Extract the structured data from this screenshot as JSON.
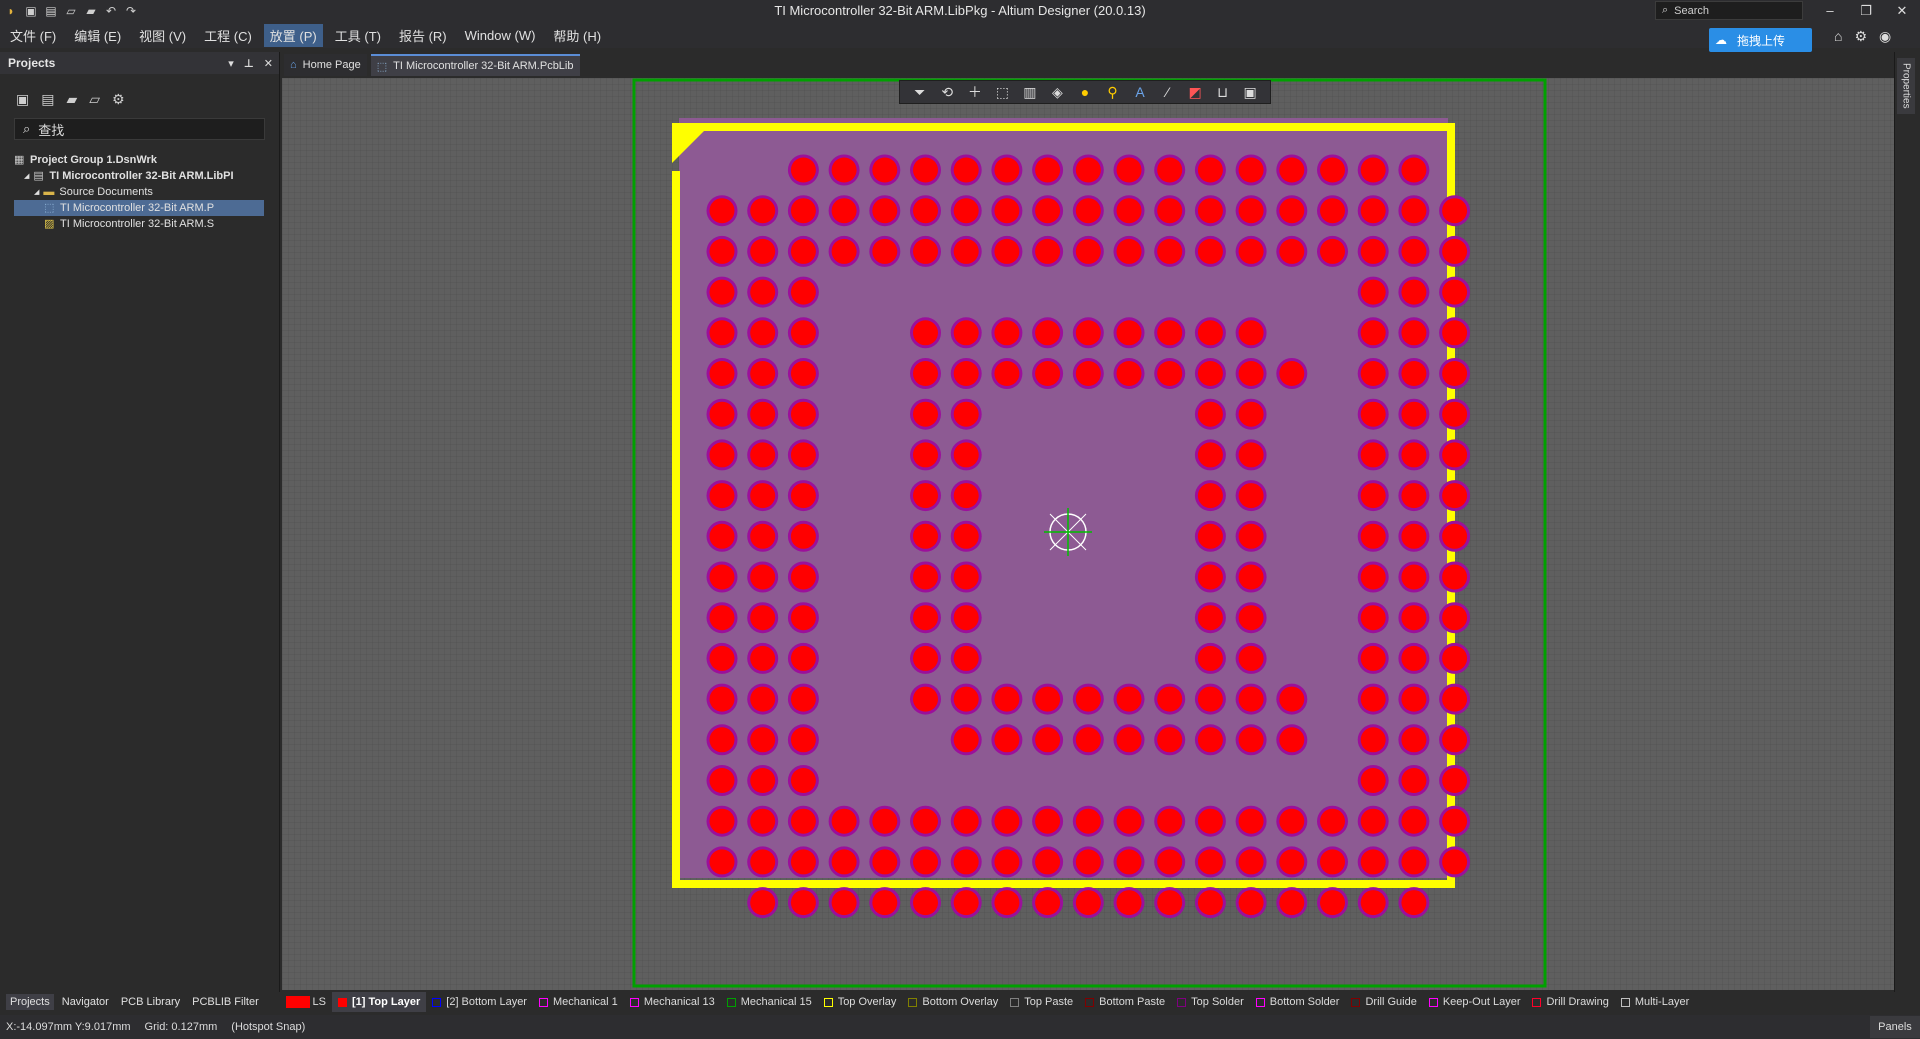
{
  "window": {
    "title": "TI Microcontroller 32-Bit ARM.LibPkg - Altium Designer (20.0.13)",
    "search_placeholder": "Search"
  },
  "menu": [
    "文件 (F)",
    "编辑 (E)",
    "视图 (V)",
    "工程 (C)",
    "放置 (P)",
    "工具 (T)",
    "报告 (R)",
    "Window (W)",
    "帮助 (H)"
  ],
  "active_menu_index": 4,
  "upload_button": "拖拽上传",
  "projects_panel": {
    "title": "Projects",
    "search_value": "查找",
    "tree": [
      {
        "label": "Project Group 1.DsnWrk",
        "level": 0,
        "bold": true,
        "icon": "project-group-icon"
      },
      {
        "label": "TI Microcontroller 32-Bit ARM.LibPI",
        "level": 1,
        "bold": true,
        "icon": "library-package-icon"
      },
      {
        "label": "Source Documents",
        "level": 2,
        "bold": false,
        "icon": "folder-icon"
      },
      {
        "label": "TI Microcontroller 32-Bit ARM.P",
        "level": 3,
        "bold": false,
        "icon": "pcblib-icon",
        "selected": true
      },
      {
        "label": "TI Microcontroller 32-Bit ARM.S",
        "level": 3,
        "bold": false,
        "icon": "schlib-icon"
      }
    ]
  },
  "doc_tabs": [
    {
      "label": "Home Page",
      "icon": "home-icon",
      "active": false
    },
    {
      "label": "TI Microcontroller 32-Bit ARM.PcbLib",
      "icon": "pcblib-icon",
      "active": true
    }
  ],
  "right_panel_tab": "Properties",
  "bottom_panel_tabs": [
    "Projects",
    "Navigator",
    "PCB Library",
    "PCBLIB Filter"
  ],
  "layer_set_label": "LS",
  "layers": [
    {
      "label": "[1] Top Layer",
      "color": "#ff0000",
      "active": true
    },
    {
      "label": "[2] Bottom Layer",
      "color": "#0000ff"
    },
    {
      "label": "Mechanical 1",
      "color": "#ff00ff"
    },
    {
      "label": "Mechanical 13",
      "color": "#ff00ff"
    },
    {
      "label": "Mechanical 15",
      "color": "#00a000"
    },
    {
      "label": "Top Overlay",
      "color": "#ffff00"
    },
    {
      "label": "Bottom Overlay",
      "color": "#808000"
    },
    {
      "label": "Top Paste",
      "color": "#808080"
    },
    {
      "label": "Bottom Paste",
      "color": "#800000"
    },
    {
      "label": "Top Solder",
      "color": "#800080"
    },
    {
      "label": "Bottom Solder",
      "color": "#ff00ff"
    },
    {
      "label": "Drill Guide",
      "color": "#800000"
    },
    {
      "label": "Keep-Out Layer",
      "color": "#ff00ff"
    },
    {
      "label": "Drill Drawing",
      "color": "#ff002a"
    },
    {
      "label": "Multi-Layer",
      "color": "#c0c0c0"
    }
  ],
  "status": {
    "coords": "X:-14.097mm Y:9.017mm",
    "grid": "Grid: 0.127mm",
    "snap": "(Hotspot Snap)"
  },
  "panels_button": "Panels",
  "colors": {
    "pad_fill": "#ff0000",
    "pad_ring": "#9b109b",
    "body": "#8d5a93",
    "overlay": "#ffff00",
    "mech15": "#00a000"
  },
  "footprint": {
    "grid_size": 19,
    "pad_rows": [
      "..OOOOOOOOOOOOOOOO.",
      "OOOOOOOOOOOOOOOOOOO",
      "OOOOOOOOOOOOOOOOOOO",
      "OOO.............OOO",
      "OOO..OOOOOOOOO..OOO",
      "OOO..OOOOOOOOOO.OOO",
      "OOO..OO.....OO..OOO",
      "OOO..OO.....OO..OOO",
      "OOO..OO.....OO..OOO",
      "OOO..OO.....OO..OOO",
      "OOO..OO.....OO..OOO",
      "OOO..OO.....OO..OOO",
      "OOO..OO.....OO..OOO",
      "OOO..OOOOOOOOOO.OOO",
      "OOO...OOOOOOOOO.OOO",
      "OOO.............OOO",
      "OOOOOOOOOOOOOOOOOOO",
      "OOOOOOOOOOOOOOOOOOO",
      ".OOOOOOOOOOOOOOOOO."
    ]
  }
}
